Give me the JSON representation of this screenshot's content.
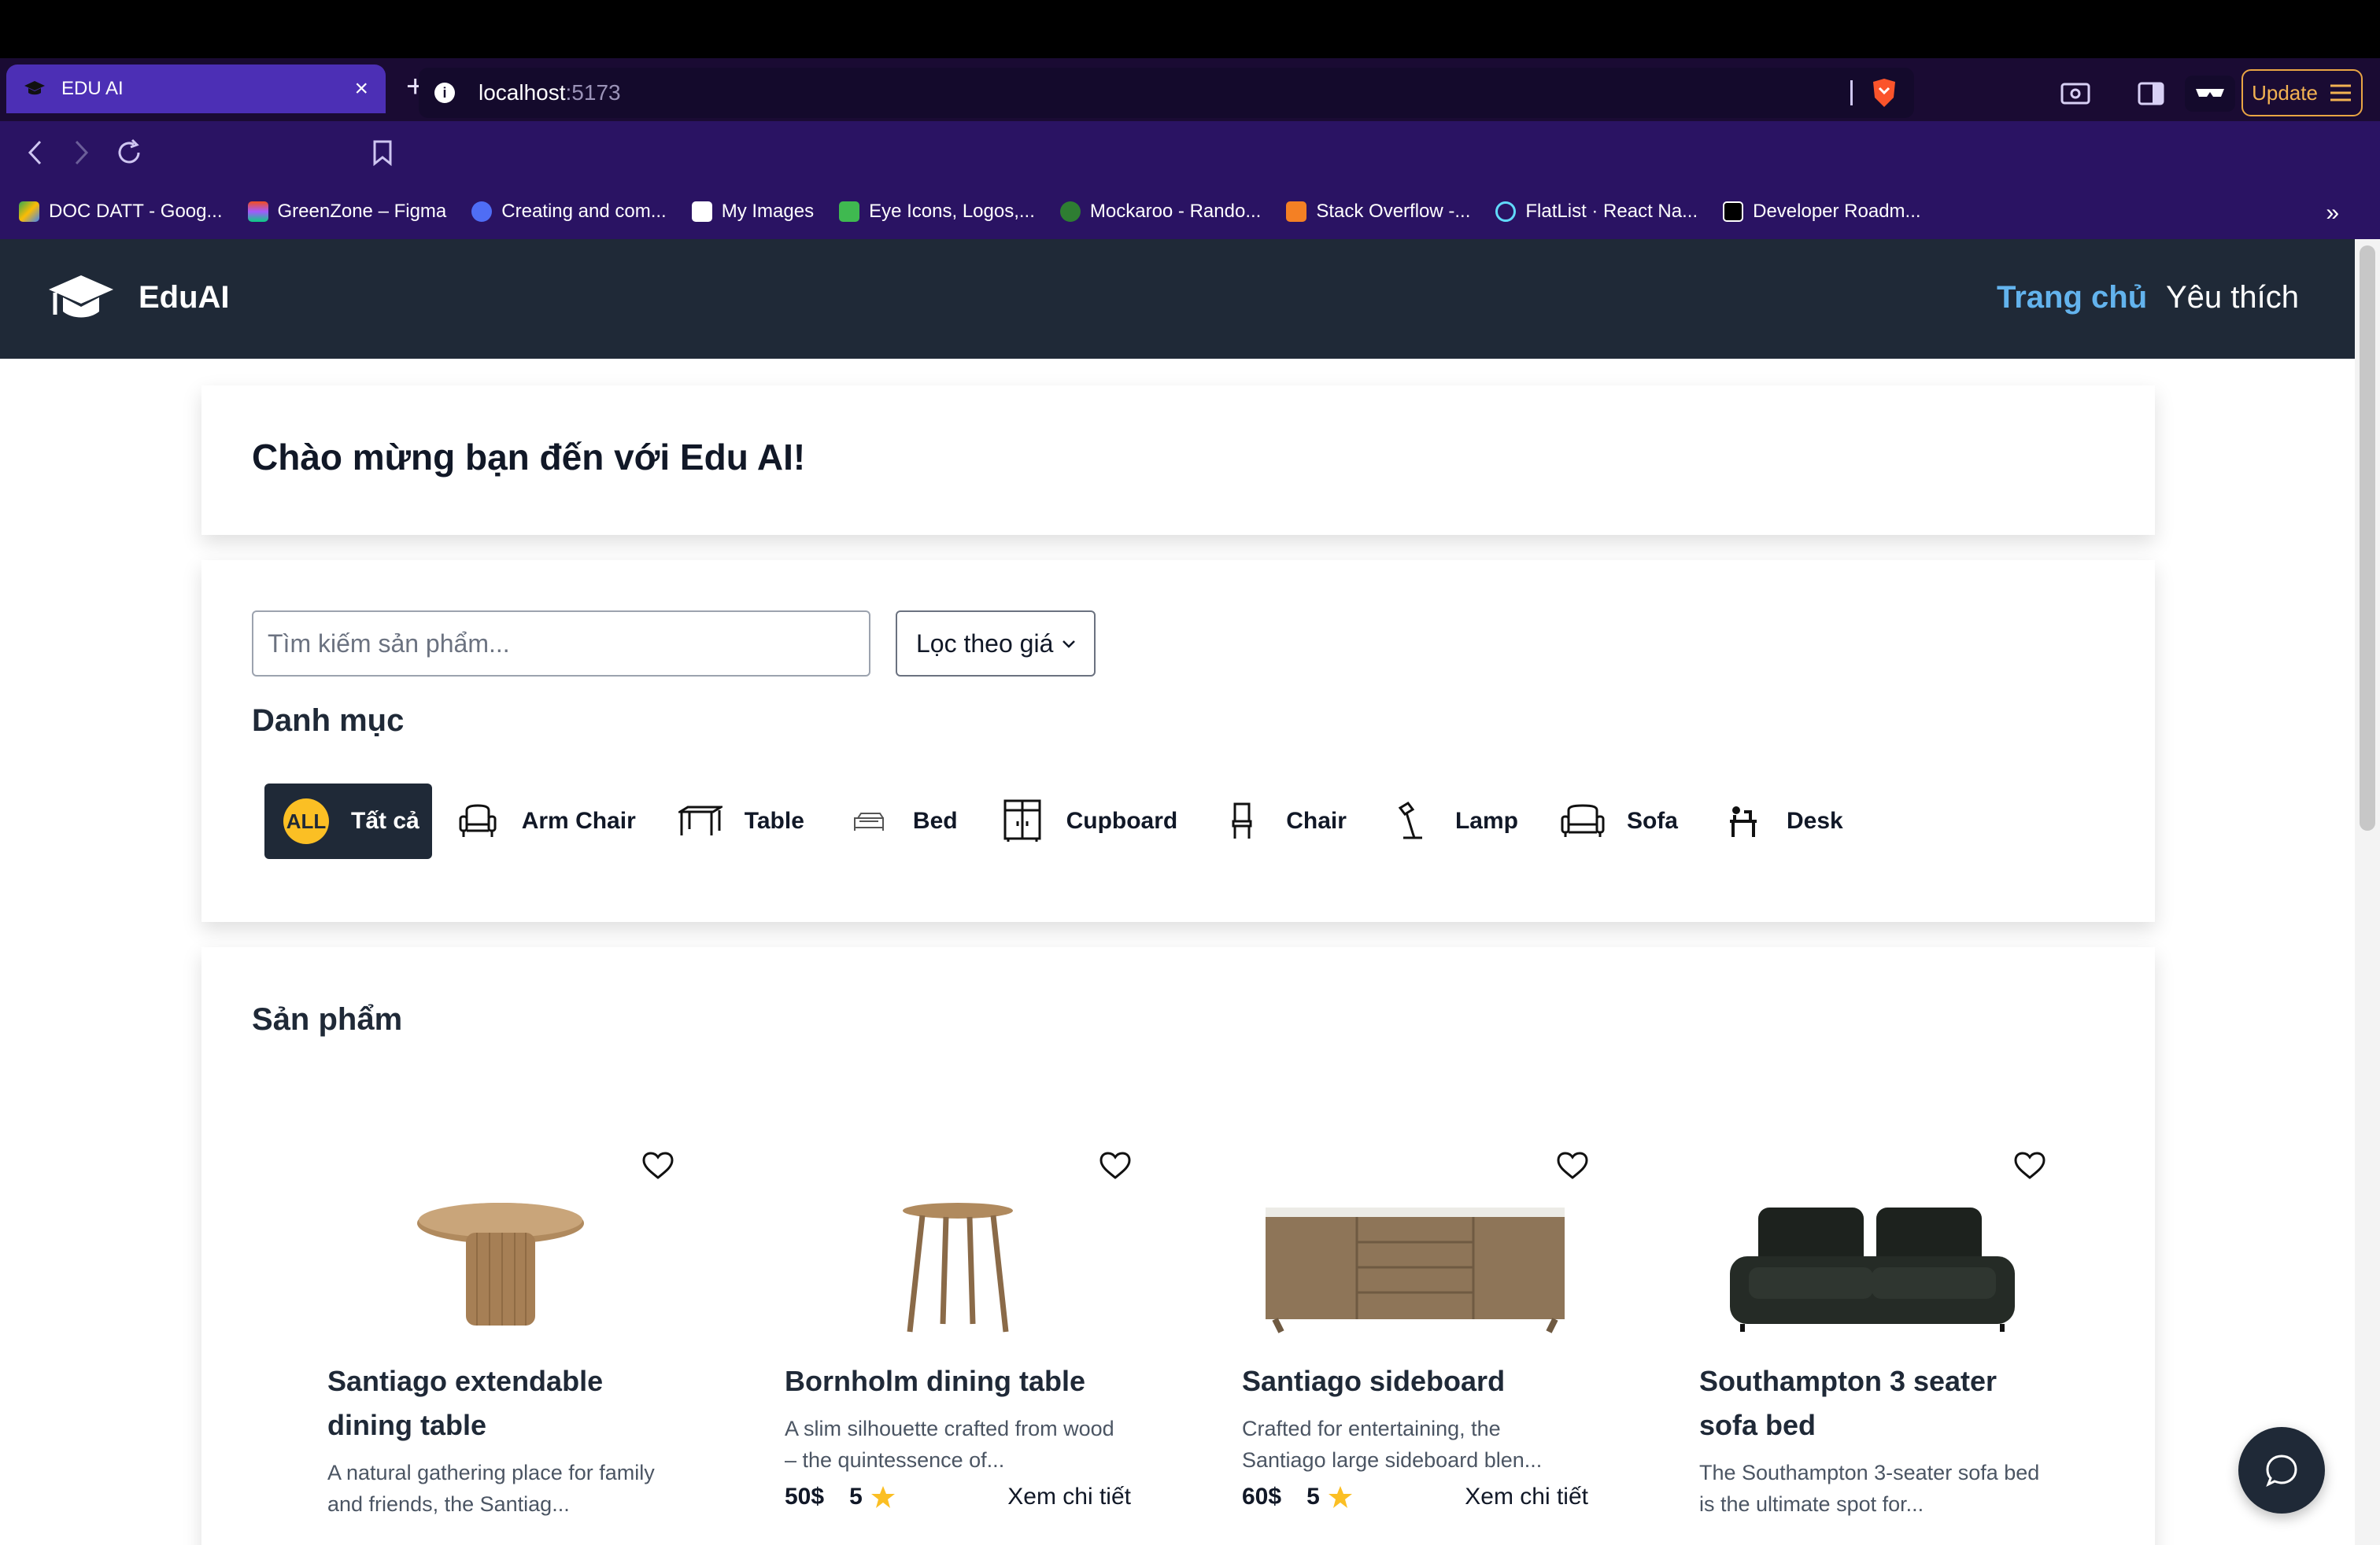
{
  "browser": {
    "tab_title": "EDU AI",
    "url_host": "localhost",
    "url_port": ":5173",
    "update_label": "Update",
    "bookmarks": [
      {
        "label": "DOC DATT - Goog...",
        "color": "#34a853"
      },
      {
        "label": "GreenZone – Figma",
        "color": "#f24e1e"
      },
      {
        "label": "Creating and com...",
        "color": "#4f6df5"
      },
      {
        "label": "My Images",
        "color": "#ffffff"
      },
      {
        "label": "Eye Icons, Logos,...",
        "color": "#3fb950"
      },
      {
        "label": "Mockaroo - Rando...",
        "color": "#2e7d32"
      },
      {
        "label": "Stack Overflow -...",
        "color": "#f48024"
      },
      {
        "label": "FlatList · React Na...",
        "color": "#61dafb"
      },
      {
        "label": "Developer Roadm...",
        "color": "#000000"
      }
    ]
  },
  "header": {
    "brand": "EduAI",
    "nav_home": "Trang chủ",
    "nav_favorites": "Yêu thích"
  },
  "welcome": {
    "title": "Chào mừng bạn đến với Edu AI!"
  },
  "filters": {
    "search_placeholder": "Tìm kiếm sản phẩm...",
    "price_filter": "Lọc theo giá",
    "categories_title": "Danh mục",
    "all_badge": "ALL",
    "categories": [
      {
        "label": "Tất cả",
        "icon": "all-icon"
      },
      {
        "label": "Arm Chair",
        "icon": "armchair-icon"
      },
      {
        "label": "Table",
        "icon": "table-icon"
      },
      {
        "label": "Bed",
        "icon": "bed-icon"
      },
      {
        "label": "Cupboard",
        "icon": "cupboard-icon"
      },
      {
        "label": "Chair",
        "icon": "chair-icon"
      },
      {
        "label": "Lamp",
        "icon": "lamp-icon"
      },
      {
        "label": "Sofa",
        "icon": "sofa-icon"
      },
      {
        "label": "Desk",
        "icon": "desk-icon"
      }
    ]
  },
  "products": {
    "title": "Sản phẩm",
    "items": [
      {
        "name": "Santiago extendable dining table",
        "desc": "A natural gathering place for family and friends, the Santiag...",
        "price": "",
        "rating": "",
        "detail": ""
      },
      {
        "name": "Bornholm dining table",
        "desc": "A slim silhouette crafted from wood – the quintessence of...",
        "price": "50$",
        "rating": "5",
        "detail": "Xem chi tiết"
      },
      {
        "name": "Santiago sideboard",
        "desc": "Crafted for entertaining, the Santiago large sideboard blen...",
        "price": "60$",
        "rating": "5",
        "detail": "Xem chi tiết"
      },
      {
        "name": "Southampton 3 seater sofa bed",
        "desc": "The Southampton 3-seater sofa bed is the ultimate spot for...",
        "price": "",
        "rating": "",
        "detail": ""
      }
    ]
  },
  "colors": {
    "header_bg": "#1f2937",
    "accent": "#63b3ed",
    "star": "#fbbf24"
  }
}
